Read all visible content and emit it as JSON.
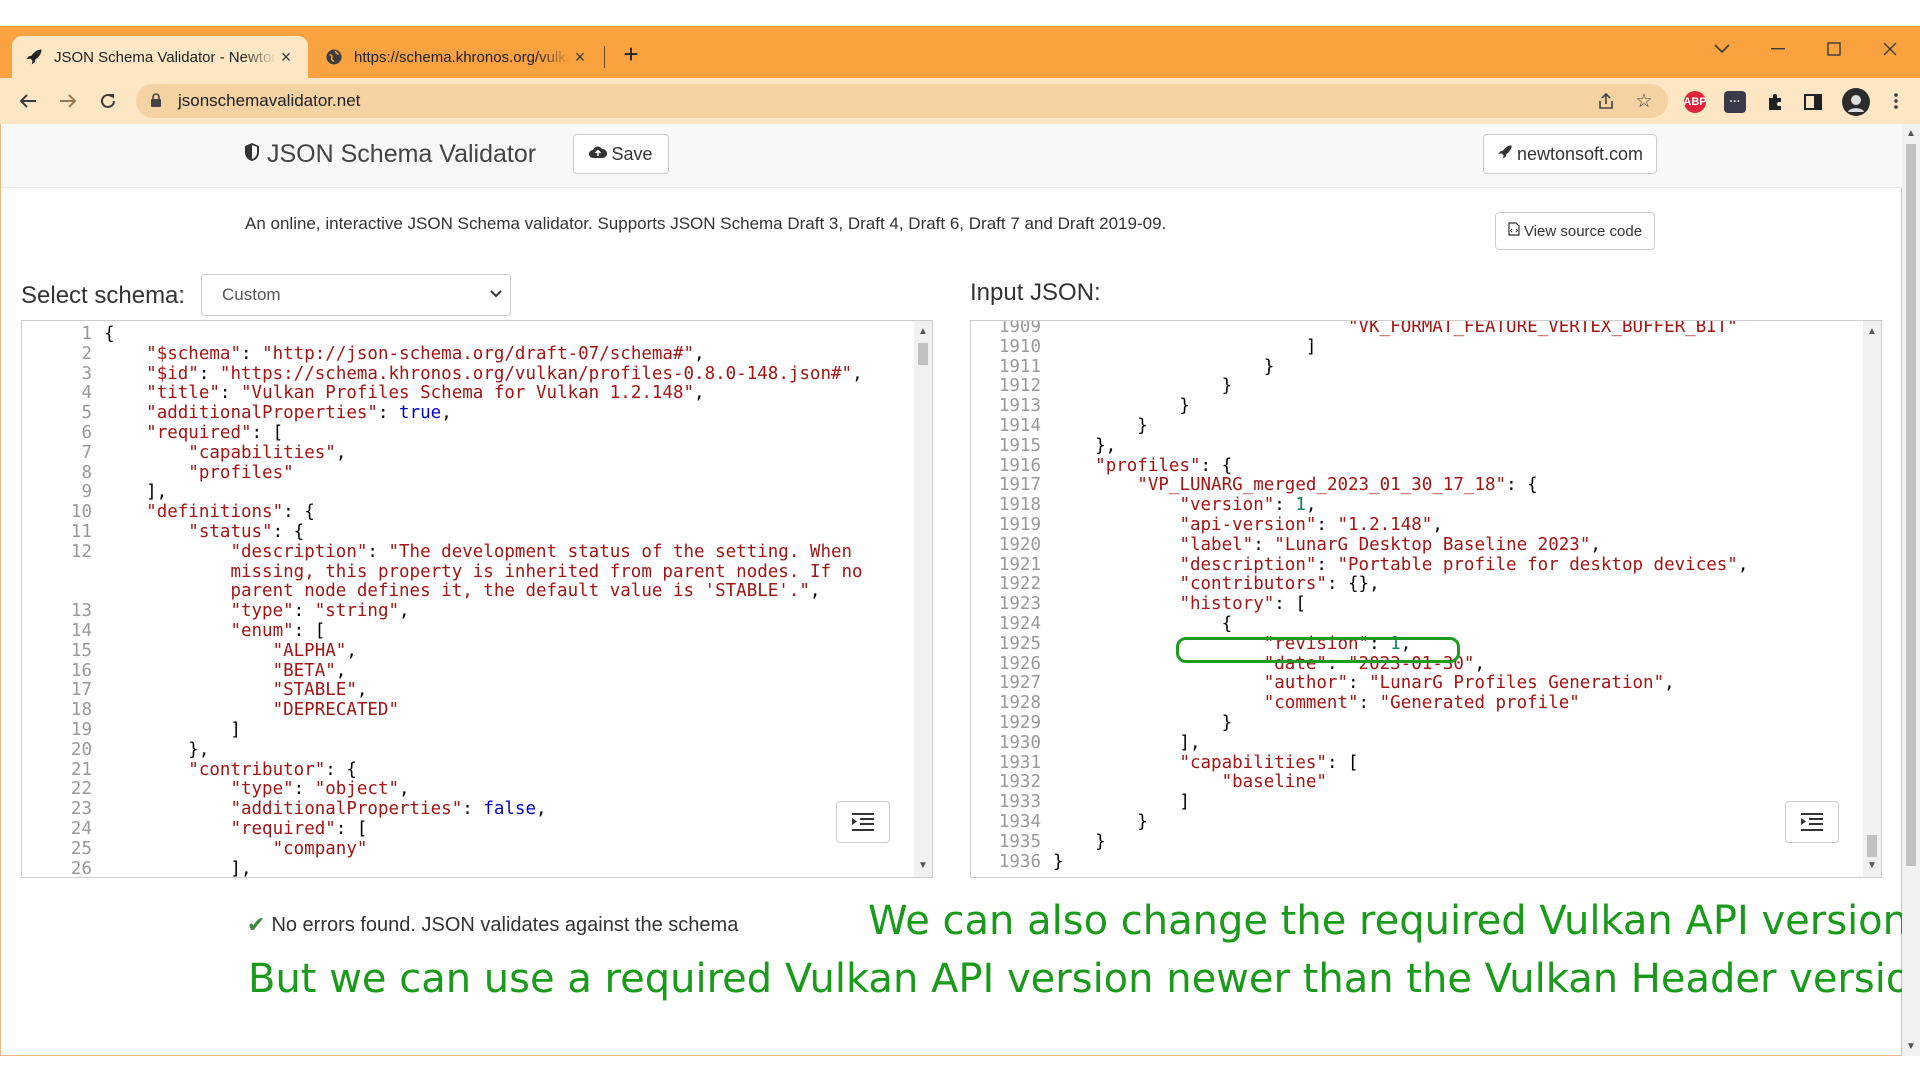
{
  "browser": {
    "tabs": [
      {
        "title": "JSON Schema Validator - Newtonsoft",
        "favicon": "rocket-icon",
        "active": true
      },
      {
        "title": "https://schema.khronos.org/vulkan/profiles",
        "favicon": "globe-icon",
        "active": false
      }
    ],
    "url": "jsonschemavalidator.net",
    "accent": "#f9a23f",
    "extensions": [
      "ABP",
      "dev",
      "puzzle",
      "sidepanel",
      "profile"
    ]
  },
  "navbar": {
    "brand": "JSON Schema Validator",
    "save_label": "Save",
    "newtonsoft_label": "newtonsoft.com"
  },
  "subtitle": "An online, interactive JSON Schema validator. Supports JSON Schema Draft 3, Draft 4, Draft 6, Draft 7 and Draft 2019-09.",
  "view_source_label": "View source code",
  "schema": {
    "label": "Select schema:",
    "selected": "Custom"
  },
  "input": {
    "label": "Input JSON:"
  },
  "status": "No errors found. JSON validates against the schema",
  "annotations": [
    "We can also change the required Vulkan API version",
    "But we can use a required Vulkan API version newer than the Vulkan Header version"
  ],
  "highlight_color": "#1e9a1e",
  "left_editor": [
    {
      "n": "1",
      "html": "{"
    },
    {
      "n": "2",
      "html": "    <span class='k'>\"$schema\"</span>: <span class='s'>\"http://json-schema.org/draft-07/schema#\"</span>,"
    },
    {
      "n": "3",
      "html": "    <span class='k'>\"$id\"</span>: <span class='s'>\"https://schema.khronos.org/vulkan/profiles-0.8.0-148.json#\"</span>,"
    },
    {
      "n": "4",
      "html": "    <span class='k'>\"title\"</span>: <span class='s'>\"Vulkan Profiles Schema for Vulkan 1.2.148\"</span>,"
    },
    {
      "n": "5",
      "html": "    <span class='k'>\"additionalProperties\"</span>: <span class='b'>true</span>,"
    },
    {
      "n": "6",
      "html": "    <span class='k'>\"required\"</span>: ["
    },
    {
      "n": "7",
      "html": "        <span class='s'>\"capabilities\"</span>,"
    },
    {
      "n": "8",
      "html": "        <span class='s'>\"profiles\"</span>"
    },
    {
      "n": "9",
      "html": "    ],"
    },
    {
      "n": "10",
      "html": "    <span class='k'>\"definitions\"</span>: {"
    },
    {
      "n": "11",
      "html": "        <span class='k'>\"status\"</span>: {"
    },
    {
      "n": "12",
      "html": "            <span class='k'>\"description\"</span>: <span class='s'>\"The development status of the setting. When</span>"
    },
    {
      "n": "",
      "html": "            <span class='s'>missing, this property is inherited from parent nodes. If no</span>"
    },
    {
      "n": "",
      "html": "            <span class='s'>parent node defines it, the default value is 'STABLE'.\"</span>,"
    },
    {
      "n": "13",
      "html": "            <span class='k'>\"type\"</span>: <span class='s'>\"string\"</span>,"
    },
    {
      "n": "14",
      "html": "            <span class='k'>\"enum\"</span>: ["
    },
    {
      "n": "15",
      "html": "                <span class='s'>\"ALPHA\"</span>,"
    },
    {
      "n": "16",
      "html": "                <span class='s'>\"BETA\"</span>,"
    },
    {
      "n": "17",
      "html": "                <span class='s'>\"STABLE\"</span>,"
    },
    {
      "n": "18",
      "html": "                <span class='s'>\"DEPRECATED\"</span>"
    },
    {
      "n": "19",
      "html": "            ]"
    },
    {
      "n": "20",
      "html": "        },"
    },
    {
      "n": "21",
      "html": "        <span class='k'>\"contributor\"</span>: {"
    },
    {
      "n": "22",
      "html": "            <span class='k'>\"type\"</span>: <span class='s'>\"object\"</span>,"
    },
    {
      "n": "23",
      "html": "            <span class='k'>\"additionalProperties\"</span>: <span class='b'>false</span>,"
    },
    {
      "n": "24",
      "html": "            <span class='k'>\"required\"</span>: ["
    },
    {
      "n": "25",
      "html": "                <span class='s'>\"company\"</span>"
    },
    {
      "n": "26",
      "html": "            ],"
    }
  ],
  "right_editor": [
    {
      "n": "1909",
      "html": "                            <span class='s'>\"VK_FORMAT_FEATURE_VERTEX_BUFFER_BIT\"</span>"
    },
    {
      "n": "1910",
      "html": "                        ]"
    },
    {
      "n": "1911",
      "html": "                    }"
    },
    {
      "n": "1912",
      "html": "                }"
    },
    {
      "n": "1913",
      "html": "            }"
    },
    {
      "n": "1914",
      "html": "        }"
    },
    {
      "n": "1915",
      "html": "    },"
    },
    {
      "n": "1916",
      "html": "    <span class='k'>\"profiles\"</span>: {"
    },
    {
      "n": "1917",
      "html": "        <span class='k'>\"VP_LUNARG_merged_2023_01_30_17_18\"</span>: {"
    },
    {
      "n": "1918",
      "html": "            <span class='k'>\"version\"</span>: <span class='n'>1</span>,"
    },
    {
      "n": "1919",
      "html": "            <span class='k'>\"api-version\"</span>: <span class='s'>\"1.2.148\"</span>,"
    },
    {
      "n": "1920",
      "html": "            <span class='k'>\"label\"</span>: <span class='s'>\"LunarG Desktop Baseline 2023\"</span>,"
    },
    {
      "n": "1921",
      "html": "            <span class='k'>\"description\"</span>: <span class='s'>\"Portable profile for desktop devices\"</span>,"
    },
    {
      "n": "1922",
      "html": "            <span class='k'>\"contributors\"</span>: {},"
    },
    {
      "n": "1923",
      "html": "            <span class='k'>\"history\"</span>: ["
    },
    {
      "n": "1924",
      "html": "                {"
    },
    {
      "n": "1925",
      "html": "                    <span class='k'>\"revision\"</span>: <span class='n'>1</span>,"
    },
    {
      "n": "1926",
      "html": "                    <span class='k'>\"date\"</span>: <span class='s'>\"2023-01-30\"</span>,"
    },
    {
      "n": "1927",
      "html": "                    <span class='k'>\"author\"</span>: <span class='s'>\"LunarG Profiles Generation\"</span>,"
    },
    {
      "n": "1928",
      "html": "                    <span class='k'>\"comment\"</span>: <span class='s'>\"Generated profile\"</span>"
    },
    {
      "n": "1929",
      "html": "                }"
    },
    {
      "n": "1930",
      "html": "            ],"
    },
    {
      "n": "1931",
      "html": "            <span class='k'>\"capabilities\"</span>: ["
    },
    {
      "n": "1932",
      "html": "                <span class='s'>\"baseline\"</span>"
    },
    {
      "n": "1933",
      "html": "            ]"
    },
    {
      "n": "1934",
      "html": "        }"
    },
    {
      "n": "1935",
      "html": "    }"
    },
    {
      "n": "1936",
      "html": "}"
    }
  ]
}
